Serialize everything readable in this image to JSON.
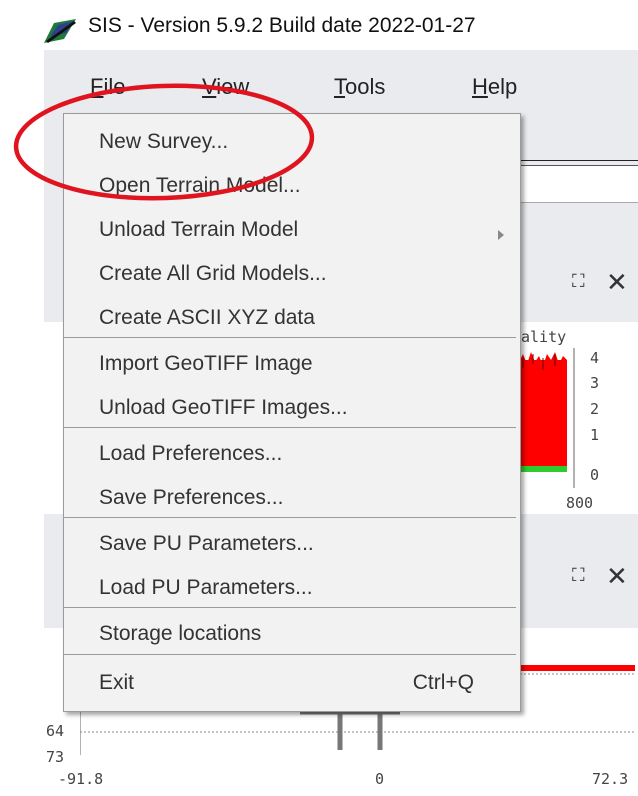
{
  "window": {
    "title": "SIS - Version 5.9.2 Build date 2022-01-27"
  },
  "menubar": [
    {
      "label": "File",
      "mnemonic": "F",
      "rest": "ile"
    },
    {
      "label": "View",
      "mnemonic": "V",
      "rest": "iew"
    },
    {
      "label": "Tools",
      "mnemonic": "T",
      "rest": "ools"
    },
    {
      "label": "Help",
      "mnemonic": "H",
      "rest": "elp"
    }
  ],
  "file_menu": {
    "items": [
      {
        "label": "New Survey..."
      },
      {
        "label": "Open Terrain Model..."
      },
      {
        "label": "Unload Terrain Model",
        "submenu": true
      },
      {
        "label": "Create All Grid Models..."
      },
      {
        "label": "Create ASCII XYZ data"
      },
      {
        "label": "Import GeoTIFF Image"
      },
      {
        "label": "Unload GeoTIFF Images..."
      },
      {
        "label": "Load Preferences..."
      },
      {
        "label": "Save Preferences..."
      },
      {
        "label": "Save PU Parameters..."
      },
      {
        "label": "Load PU Parameters..."
      },
      {
        "label": "Storage locations"
      },
      {
        "label": "Exit",
        "shortcut": "Ctrl+Q"
      }
    ]
  },
  "background": {
    "quality_chart": {
      "label": "ality",
      "y_ticks": [
        "4",
        "3",
        "2",
        "1",
        "0"
      ],
      "x_tick_right": "800"
    },
    "depth_chart": {
      "y_ticks": [
        "64",
        "73"
      ],
      "x_ticks": [
        "-91.8",
        "0",
        "72.3"
      ]
    }
  },
  "colors": {
    "highlight_ellipse": "#e0141e",
    "menu_background": "#f2f2f2",
    "chart_red": "#ff0000",
    "chart_green": "#2ecc2e"
  },
  "icons": [
    "app-logo-icon",
    "maximize-icon",
    "close-icon",
    "submenu-arrow-icon"
  ]
}
